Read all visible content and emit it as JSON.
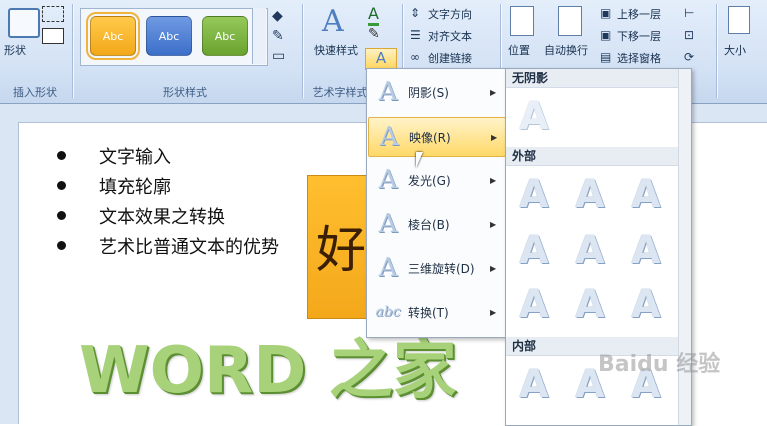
{
  "ribbon": {
    "shape_label": "形状",
    "insert_shapes_group": "插入形状",
    "shape_styles_group": "形状样式",
    "tiles": [
      {
        "label": "Abc",
        "color": "#f3a81a"
      },
      {
        "label": "Abc",
        "color": "#3c6fc9"
      },
      {
        "label": "Abc",
        "color": "#6aa32f"
      }
    ],
    "quick_styles": "快速样式",
    "wordart_group": "艺术字样式",
    "text_direction": "文字方向",
    "align_text": "对齐文本",
    "create_link": "创建链接",
    "position": "位置",
    "wrap_text": "自动换行",
    "bring_forward": "上移一层",
    "send_backward": "下移一层",
    "selection_pane": "选择窗格",
    "size": "大小"
  },
  "doc": {
    "bullets": [
      "文字输入",
      "填充轮廓",
      "文本效果之转换",
      "艺术比普通文本的优势"
    ],
    "shape_char": "好",
    "wordart": "WORD 之家"
  },
  "menu": {
    "items": [
      {
        "label": "阴影(S)",
        "icon": "A"
      },
      {
        "label": "映像(R)",
        "icon": "A"
      },
      {
        "label": "发光(G)",
        "icon": "A"
      },
      {
        "label": "棱台(B)",
        "icon": "A"
      },
      {
        "label": "三维旋转(D)",
        "icon": "A"
      },
      {
        "label": "转换(T)",
        "icon": "abc"
      }
    ]
  },
  "submenu": {
    "sections": [
      "无阴影",
      "外部",
      "内部"
    ],
    "glyph": "A"
  },
  "watermark": "Baidu 经验"
}
